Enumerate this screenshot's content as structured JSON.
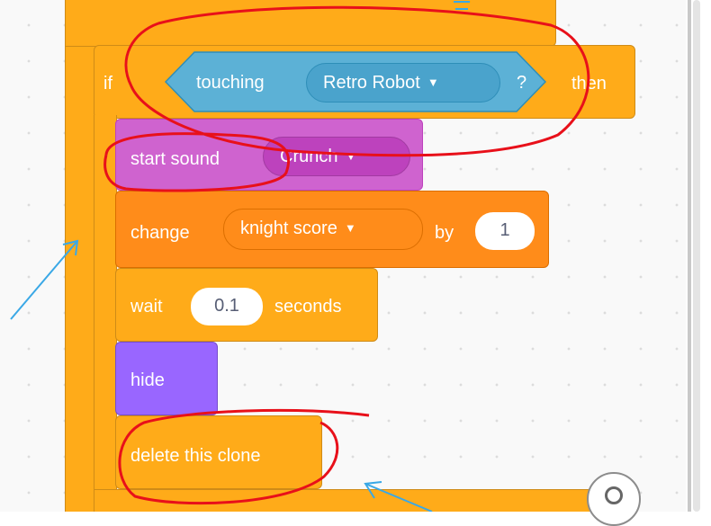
{
  "colors": {
    "control": "#ffab19",
    "sensing": "#5cb1d6",
    "sound": "#cf63cf",
    "variables": "#ff8c1a",
    "looks": "#9966ff",
    "annotation_red": "#e8101a",
    "annotation_blue": "#3aa8e6"
  },
  "script": {
    "if_block": {
      "if_label": "if",
      "then_label": "then",
      "condition": {
        "label": "touching",
        "target": "Retro Robot",
        "question_mark": "?"
      }
    },
    "start_sound": {
      "label": "start sound",
      "sound": "Crunch"
    },
    "change_variable": {
      "label": "change",
      "variable": "knight score",
      "by_label": "by",
      "amount": "1"
    },
    "wait": {
      "label": "wait",
      "value": "0.1",
      "unit_label": "seconds"
    },
    "hide": {
      "label": "hide"
    },
    "delete_clone": {
      "label": "delete this clone"
    }
  },
  "icons": {
    "dropdown_caret": "caret-down-icon",
    "zoom": "zoom-reset-icon"
  }
}
